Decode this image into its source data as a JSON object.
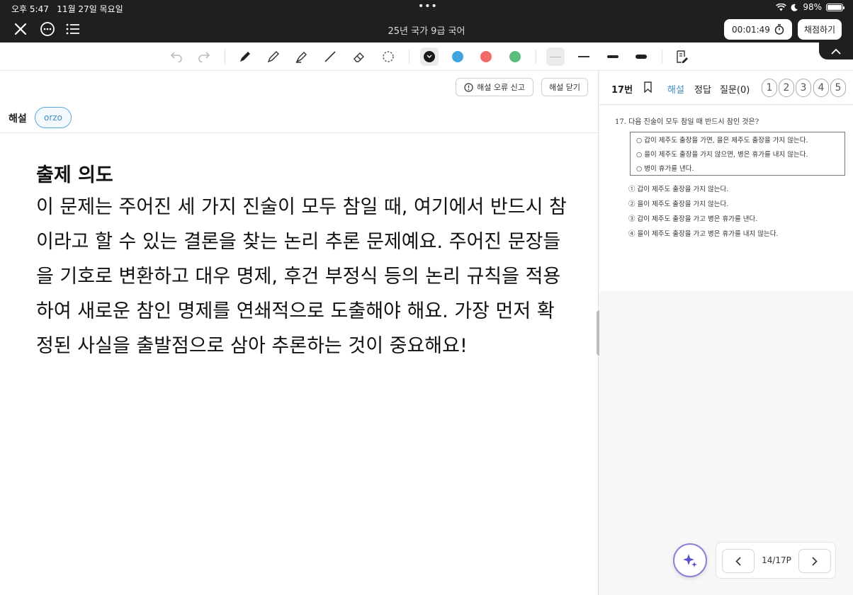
{
  "status_bar": {
    "time": "오후 5:47",
    "date": "11월 27일 목요일",
    "battery": "98%",
    "battery_level": 0.98
  },
  "title_bar": {
    "title": "25년 국가 9급 국어",
    "timer": "00:01:49",
    "grade_button": "채점하기"
  },
  "toolbar": {
    "colors": [
      "#1a1a1a",
      "#3fa3e0",
      "#f06a6a",
      "#5bbd7c"
    ],
    "icons": [
      "undo-icon",
      "redo-icon",
      "pen-icon",
      "pencil-icon",
      "highlighter-icon",
      "line-icon",
      "eraser-icon",
      "lasso-icon",
      "memo-icon"
    ]
  },
  "left_pane": {
    "report_error_button": "해설 오류 신고",
    "close_solution_button": "해설 닫기",
    "section_label": "해설",
    "source_chip": "orzo",
    "heading": "출제 의도",
    "body": "이 문제는 주어진 세 가지 진술이 모두 참일 때, 여기에서 반드시 참이라고 할 수 있는 결론을 찾는 논리 추론 문제예요. 주어진 문장들을 기호로 변환하고 대우 명제, 후건 부정식 등의 논리 규칙을 적용하여 새로운 참인 명제를 연쇄적으로 도출해야 해요. 가장 먼저 확정된 사실을 출발점으로 삼아 추론하는 것이 중요해요!"
  },
  "right_pane": {
    "question_number": "17번",
    "tabs": {
      "solution": "해설",
      "answer": "정답",
      "questions": "질문(0)"
    },
    "choices": [
      "1",
      "2",
      "3",
      "4",
      "5"
    ],
    "question": {
      "title": "17. 다음 진술이 모두 참일 때 반드시 참인 것은?",
      "premises": [
        "○ 갑이 제주도 출장을 가면, 을은 제주도 출장을 가지 않는다.",
        "○ 을이 제주도 출장을 가지 않으면, 병은 휴가를 내지 않는다.",
        "○ 병이 휴가를 낸다."
      ],
      "options": [
        "① 갑이 제주도 출장을 가지 않는다.",
        "② 을이 제주도 출장을 가지 않는다.",
        "③ 갑이 제주도 출장을 가고 병은 휴가를 낸다.",
        "④ 을이 제주도 출장을 가고 병은 휴가를 내지 않는다."
      ]
    }
  },
  "pager": {
    "page": "14/17P"
  }
}
